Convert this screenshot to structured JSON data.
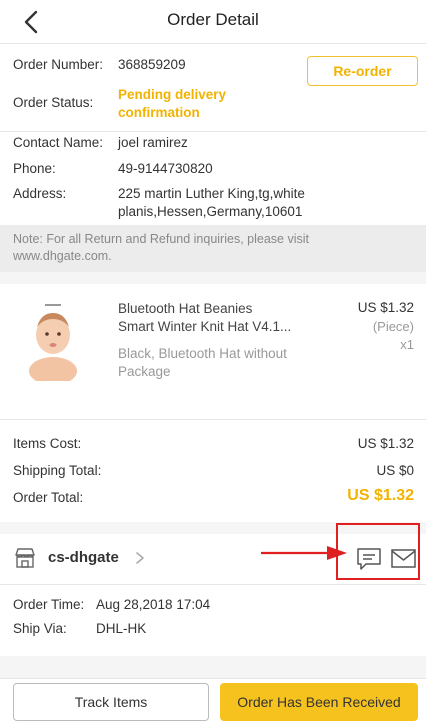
{
  "header": {
    "title": "Order Detail"
  },
  "order": {
    "number_label": "Order Number:",
    "number": "368859209",
    "status_label": "Order Status:",
    "status_line1": "Pending delivery",
    "status_line2": "confirmation",
    "reorder_label": "Re-order"
  },
  "contact": {
    "name_label": "Contact Name:",
    "name": "joel ramirez",
    "phone_label": "Phone:",
    "phone": "49-9144730820",
    "address_label": "Address:",
    "address_line1": "225 martin Luther King,tg,white",
    "address_line2": "planis,Hessen,Germany,10601"
  },
  "note": {
    "line1": "Note: For all Return and Refund inquiries, please visit",
    "line2": "www.dhgate.com."
  },
  "product": {
    "name_line1": "Bluetooth Hat Beanies",
    "name_line2": "Smart Winter Knit Hat V4.1...",
    "variant_line1": "Black, Bluetooth Hat without",
    "variant_line2": "Package",
    "price": "US $1.32",
    "unit": "(Piece)",
    "quantity": "x1"
  },
  "costs": {
    "items_label": "Items Cost:",
    "items_value": "US $1.32",
    "shipping_label": "Shipping Total:",
    "shipping_value": "US $0",
    "total_label": "Order Total:",
    "total_value": "US $1.32"
  },
  "store": {
    "name": "cs-dhgate"
  },
  "shipping": {
    "time_label": "Order Time:",
    "time_value": "Aug 28,2018 17:04",
    "via_label": "Ship Via:",
    "via_value": "DHL-HK"
  },
  "actions": {
    "track_label": "Track Items",
    "received_label": "Order Has Been Received"
  },
  "colors": {
    "accent": "#f2b300",
    "button_yellow": "#f6c21d",
    "highlight_red": "#e02020"
  },
  "icons": {
    "back": "chevron-left-icon",
    "store": "store-icon",
    "chat": "chat-icon",
    "mail": "mail-icon",
    "annotation_arrow": "arrow-right-icon"
  }
}
